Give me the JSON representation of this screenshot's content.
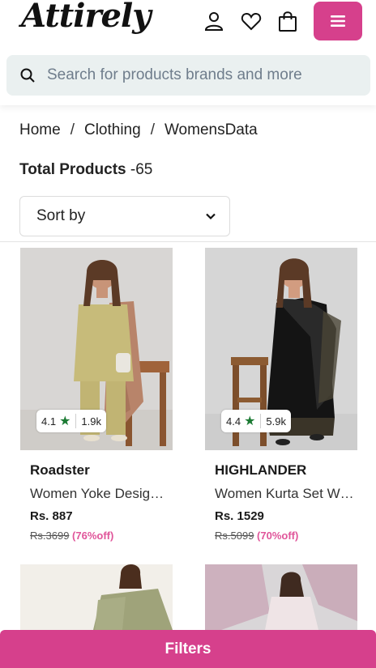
{
  "header": {
    "logo": "Attirely",
    "icons": [
      "user-icon",
      "heart-icon",
      "bag-icon",
      "menu-icon"
    ]
  },
  "search": {
    "placeholder": "Search for products brands and more"
  },
  "breadcrumb": [
    "Home",
    "Clothing",
    "WomensData"
  ],
  "breadcrumb_separator": "/",
  "total": {
    "label": "Total Products",
    "value": "-65"
  },
  "sort": {
    "label": "Sort by"
  },
  "products": [
    {
      "brand": "Roadster",
      "name": "Women Yoke Design Kurta",
      "price": "Rs. 887",
      "mrp": "Rs.3699",
      "off": "(76%off)",
      "rating": "4.1",
      "reviews": "1.9k"
    },
    {
      "brand": "HIGHLANDER",
      "name": "Women Kurta Set With Dupatta",
      "price": "Rs. 1529",
      "mrp": "Rs.5099",
      "off": "(70%off)",
      "rating": "4.4",
      "reviews": "5.9k"
    }
  ],
  "filters_button": "Filters",
  "colors": {
    "accent": "#d6408c",
    "star": "#1b7a33",
    "search_bg": "#eaf0f0"
  }
}
